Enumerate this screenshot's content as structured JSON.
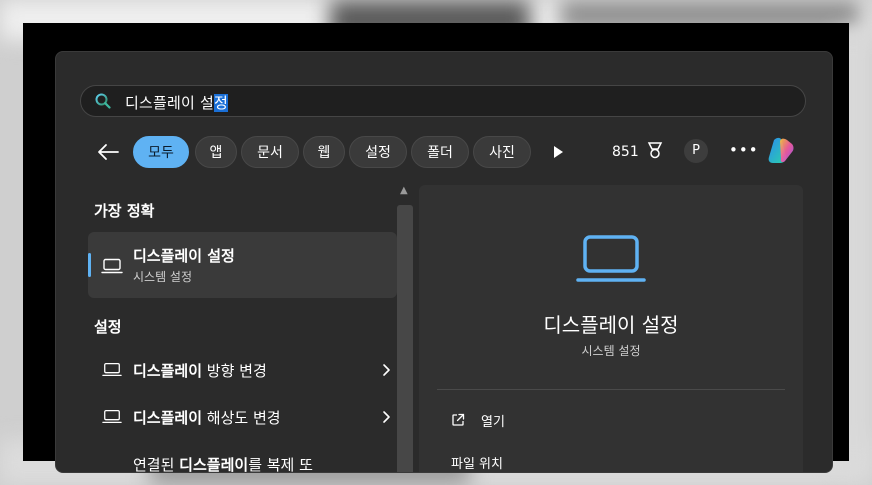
{
  "search": {
    "query_prefix": "디스플레이 설",
    "query_selected": "정"
  },
  "filters": {
    "chips": [
      "모두",
      "앱",
      "문서",
      "웹",
      "설정",
      "폴더",
      "사진"
    ],
    "points": "851",
    "profile_initial": "P",
    "more": "•••"
  },
  "best_match": {
    "section_title": "가장 정확",
    "title": "디스플레이 설정",
    "subtitle": "시스템 설정"
  },
  "settings": {
    "section_title": "설정",
    "items": [
      {
        "bold": "디스플레이",
        "rest": " 방향 변경"
      },
      {
        "bold": "디스플레이",
        "rest": " 해상도 변경"
      },
      {
        "pre": "연결된 ",
        "bold": "디스플레이",
        "rest": "를 복제 또"
      }
    ]
  },
  "detail": {
    "title": "디스플레이 설정",
    "subtitle": "시스템 설정",
    "actions": [
      "열기",
      "파일 위치"
    ]
  },
  "colors": {
    "accent": "#5fb2f3",
    "panel": "#2b2b2b",
    "card": "#323232",
    "selection": "#1a6fd6"
  },
  "icons": [
    "search-icon",
    "back-arrow-icon",
    "play-icon",
    "medal-icon",
    "copilot-icon",
    "laptop-icon",
    "chevron-right-icon",
    "open-external-icon"
  ]
}
